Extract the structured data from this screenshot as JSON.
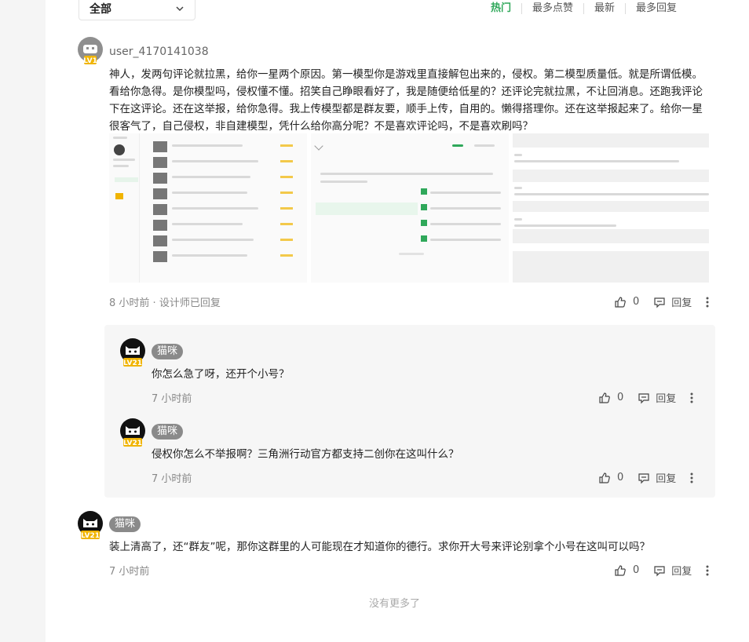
{
  "filter": {
    "selected": "全部"
  },
  "sort_tabs": [
    {
      "label": "热门"
    },
    {
      "label": "最多点赞"
    },
    {
      "label": "最新"
    },
    {
      "label": "最多回复"
    }
  ],
  "comment": {
    "username": "user_4170141038",
    "level": "LV1",
    "text": "神人，发两句评论就拉黑，给你一星两个原因。第一模型你是游戏里直接解包出来的，侵权。第二模型质量低。就是所谓低模。看给你急得。是你模型吗，侵权懂不懂。招笑自己睁眼看好了，我是随便给低星的？还评论完就拉黑，不让回消息。还跑我评论下在这评论。还在这举报，给你急得。我上传模型都是群友要，顺手上传，自用的。懒得搭理你。还在这举报起来了。给你一星很客气了，自己侵权，非自建模型，凭什么给你高分呢？不是喜欢评论吗，不是喜欢刷吗？",
    "time": "8 小时前",
    "status": "设计师已回复",
    "likes": "0",
    "reply_label": "回复"
  },
  "replies": [
    {
      "username": "猫咪",
      "level": "LV21",
      "text": "你怎么急了呀，还开个小号？",
      "time": "7 小时前",
      "likes": "0",
      "reply_label": "回复"
    },
    {
      "username": "猫咪",
      "level": "LV21",
      "text": "侵权你怎么不举报啊？三角洲行动官方都支持二创你在这叫什么？",
      "time": "7 小时前",
      "likes": "0",
      "reply_label": "回复"
    }
  ],
  "comment2": {
    "username": "猫咪",
    "level": "LV21",
    "text": "装上清高了，还“群友”呢，那你这群里的人可能现在才知道你的德行。求你开大号来评论别拿个小号在这叫可以吗？",
    "time": "7 小时前",
    "likes": "0",
    "reply_label": "回复"
  },
  "end_text": "没有更多了",
  "colors": {
    "accent": "#2fa85a",
    "level_badge": "#f0b400"
  }
}
